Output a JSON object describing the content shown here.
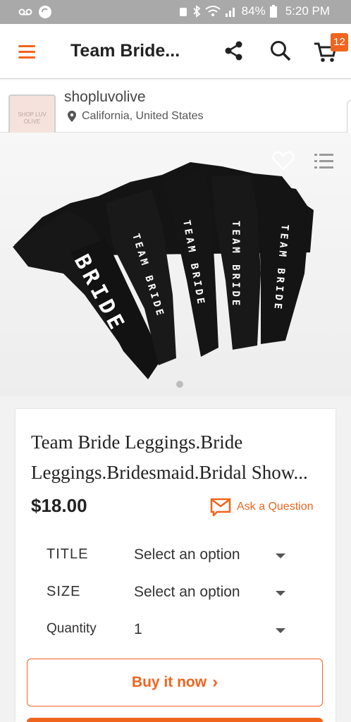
{
  "status_bar": {
    "battery": "84%",
    "time": "5:20 PM"
  },
  "app_bar": {
    "title": "Team Bride...",
    "cart_count": "12"
  },
  "shop": {
    "name": "shopluvolive",
    "location": "California, United States",
    "logo_text": "SHOP LUV OLIVE"
  },
  "hero": {
    "legging_texts": [
      "BRIDE",
      "TEAM BRIDE",
      "TEAM BRIDE",
      "TEAM BRIDE",
      "TEAM BRIDE"
    ]
  },
  "product": {
    "title": "Team Bride Leggings.Bride Leggings.Bridesmaid.Bridal Show...",
    "price": "$18.00",
    "ask_label": "Ask a Question"
  },
  "options": [
    {
      "label": "TITLE",
      "value": "Select an option"
    },
    {
      "label": "SIZE",
      "value": "Select an option"
    },
    {
      "label": "Quantity",
      "value": "1"
    }
  ],
  "actions": {
    "buy_now": "Buy it now",
    "buy_arrow": "›"
  },
  "colors": {
    "accent": "#f1641e",
    "status_bar": "#a9a9a9"
  }
}
